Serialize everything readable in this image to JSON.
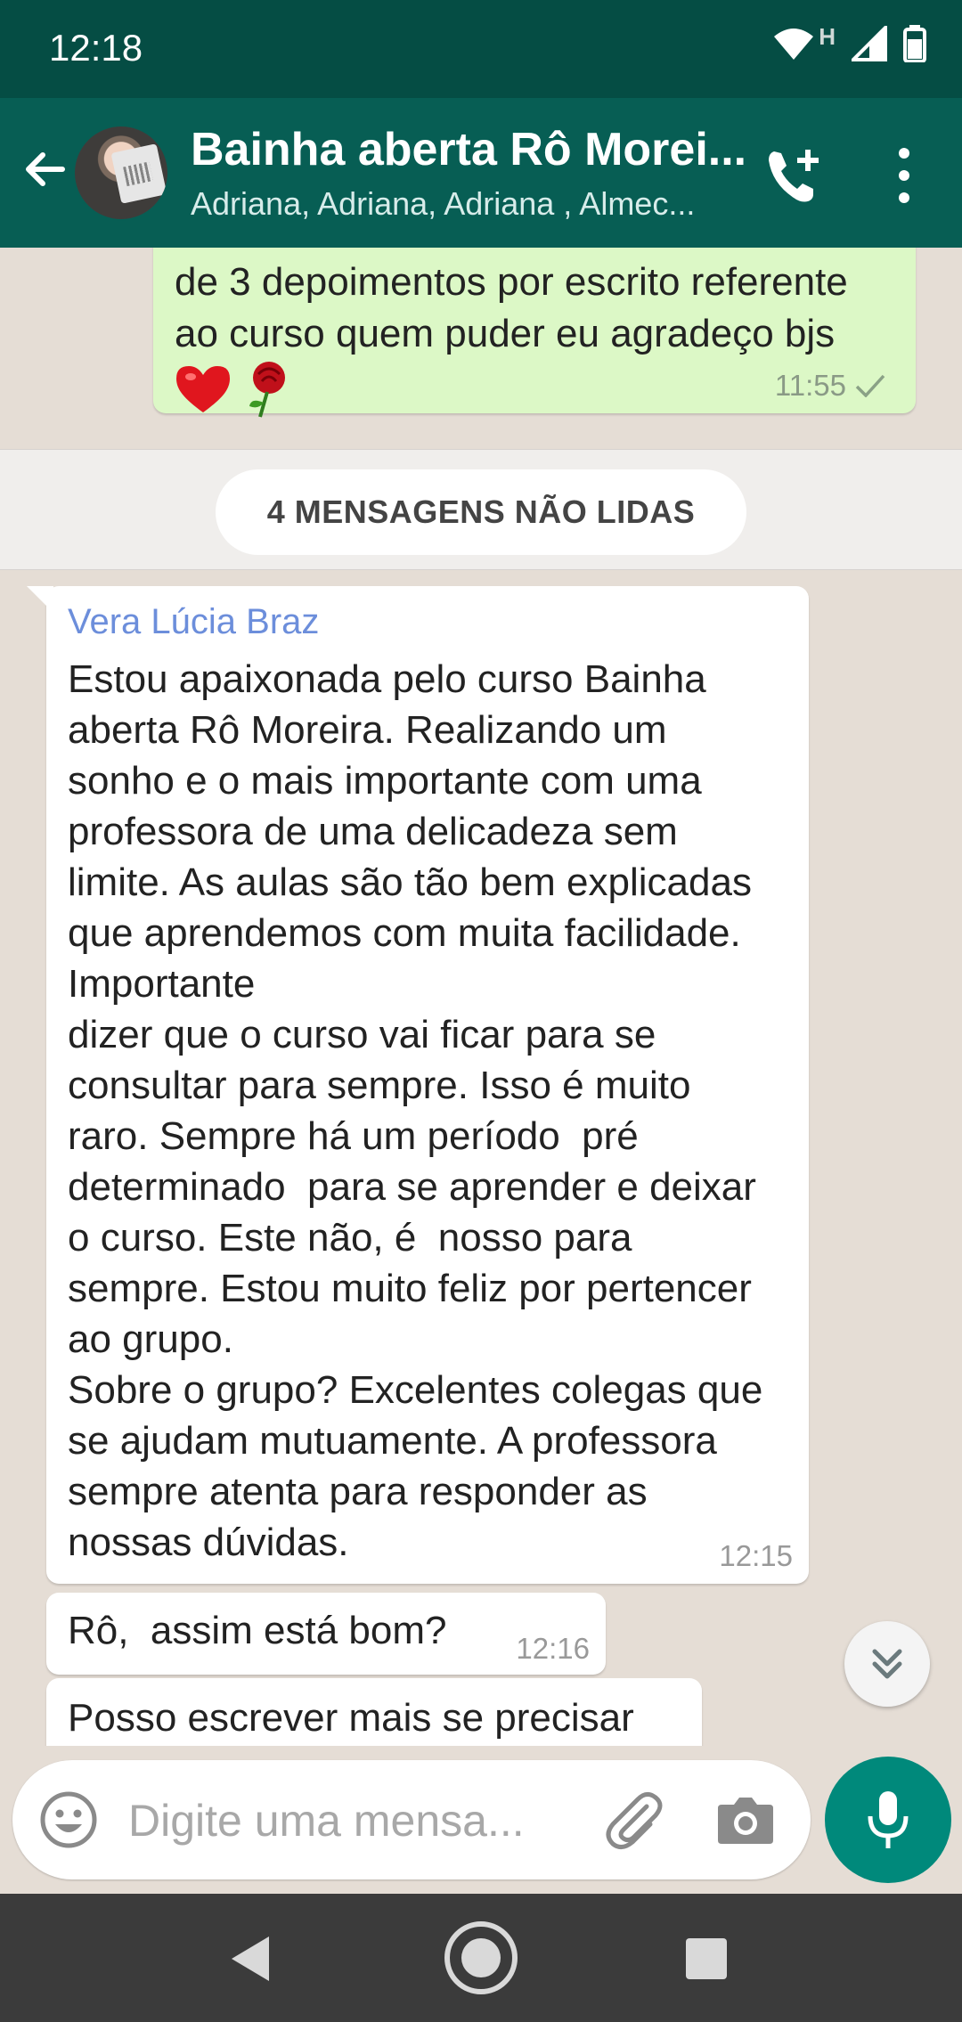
{
  "status_bar": {
    "time": "12:18",
    "network_label": "H"
  },
  "header": {
    "title": "Bainha aberta Rô Morei...",
    "subtitle": "Adriana, Adriana, Adriana , Almec...",
    "icons": [
      "back-arrow-icon",
      "group-avatar",
      "add-call-icon",
      "overflow-menu-icon"
    ]
  },
  "messages": {
    "outgoing": {
      "text": "de 3 depoimentos por escrito referente ao curso quem puder eu agradeço bjs",
      "time": "11:55"
    },
    "unread_divider": "4 MENSAGENS NÃO LIDAS",
    "incoming": [
      {
        "sender": "Vera Lúcia Braz",
        "text": "Estou apaixonada pelo curso Bainha aberta Rô Moreira. Realizando um sonho e o mais importante com uma professora de uma delicadeza sem limite. As aulas são tão bem explicadas que aprendemos com muita facilidade. Importante\ndizer que o curso vai ficar para se consultar para sempre. Isso é muito raro. Sempre há um período  pré determinado  para se aprender e deixar o curso. Este não, é  nosso para sempre. Estou muito feliz por pertencer ao grupo.\nSobre o grupo? Excelentes colegas que se ajudam mutuamente. A professora sempre atenta para responder as nossas dúvidas.",
        "time": "12:15"
      },
      {
        "text": "Rô,  assim está bom?",
        "time": "12:16"
      },
      {
        "text": "Posso escrever mais se precisar"
      }
    ]
  },
  "composer": {
    "placeholder": "Digite uma mensa..."
  },
  "colors": {
    "header": "#075e54",
    "status_bar": "#054d44",
    "outgoing_bubble": "#dcf8c6",
    "accent": "#00897b",
    "sender_name": "#6c8edb"
  }
}
